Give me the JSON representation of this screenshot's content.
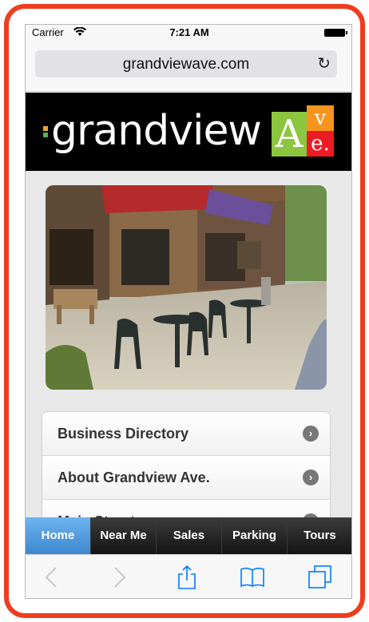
{
  "status_bar": {
    "carrier": "Carrier",
    "time": "7:21 AM"
  },
  "browser": {
    "url": "grandviewave.com"
  },
  "site": {
    "logo_text": "grandview",
    "logo_ave": {
      "a": "A",
      "v": "v",
      "e": "e."
    }
  },
  "menu": {
    "items": [
      {
        "label": "Business Directory"
      },
      {
        "label": "About Grandview Ave."
      },
      {
        "label": "Main Street"
      }
    ]
  },
  "tabs": [
    {
      "label": "Home",
      "active": true
    },
    {
      "label": "Near Me",
      "active": false
    },
    {
      "label": "Sales",
      "active": false
    },
    {
      "label": "Parking",
      "active": false
    },
    {
      "label": "Tours",
      "active": false
    }
  ],
  "colors": {
    "accent_frame": "#f03c1e",
    "tab_active": "#4a90d9",
    "ios_blue": "#007aff"
  },
  "icons": [
    "wifi-icon",
    "battery-icon",
    "reload-icon",
    "chevron-right-icon",
    "back-icon",
    "forward-icon",
    "share-icon",
    "bookmarks-icon",
    "tabs-icon"
  ]
}
